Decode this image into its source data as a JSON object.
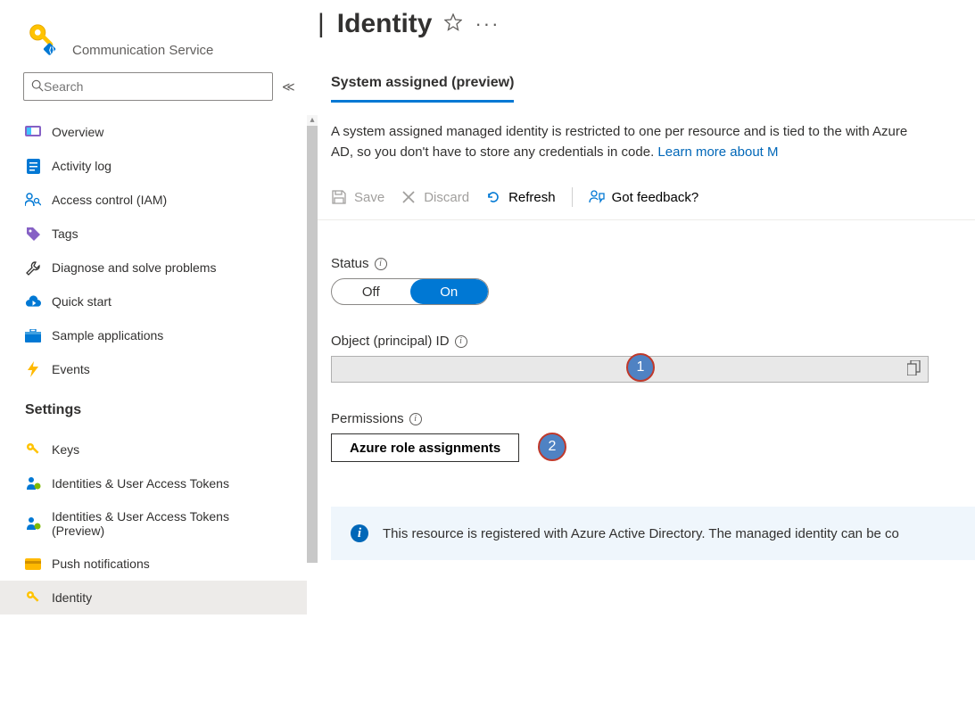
{
  "header": {
    "service_label": "Communication Service",
    "title": "Identity"
  },
  "search": {
    "placeholder": "Search"
  },
  "sidebar": {
    "items": [
      {
        "label": "Overview"
      },
      {
        "label": "Activity log"
      },
      {
        "label": "Access control (IAM)"
      },
      {
        "label": "Tags"
      },
      {
        "label": "Diagnose and solve problems"
      },
      {
        "label": "Quick start"
      },
      {
        "label": "Sample applications"
      },
      {
        "label": "Events"
      }
    ],
    "settings_title": "Settings",
    "settings_items": [
      {
        "label": "Keys"
      },
      {
        "label": "Identities & User Access Tokens"
      },
      {
        "label": "Identities & User Access Tokens (Preview)"
      },
      {
        "label": "Push notifications"
      },
      {
        "label": "Identity"
      }
    ]
  },
  "tab": {
    "label": "System assigned (preview)"
  },
  "description": {
    "text": "A system assigned managed identity is restricted to one per resource and is tied to the with Azure AD, so you don't have to store any credentials in code. ",
    "link": "Learn more about M"
  },
  "toolbar": {
    "save": "Save",
    "discard": "Discard",
    "refresh": "Refresh",
    "feedback": "Got feedback?"
  },
  "form": {
    "status_label": "Status",
    "off": "Off",
    "on": "On",
    "object_id_label": "Object (principal) ID",
    "permissions_label": "Permissions",
    "perm_button": "Azure role assignments"
  },
  "callouts": {
    "one": "1",
    "two": "2"
  },
  "banner": {
    "text": "This resource is registered with Azure Active Directory. The managed identity can be co"
  }
}
